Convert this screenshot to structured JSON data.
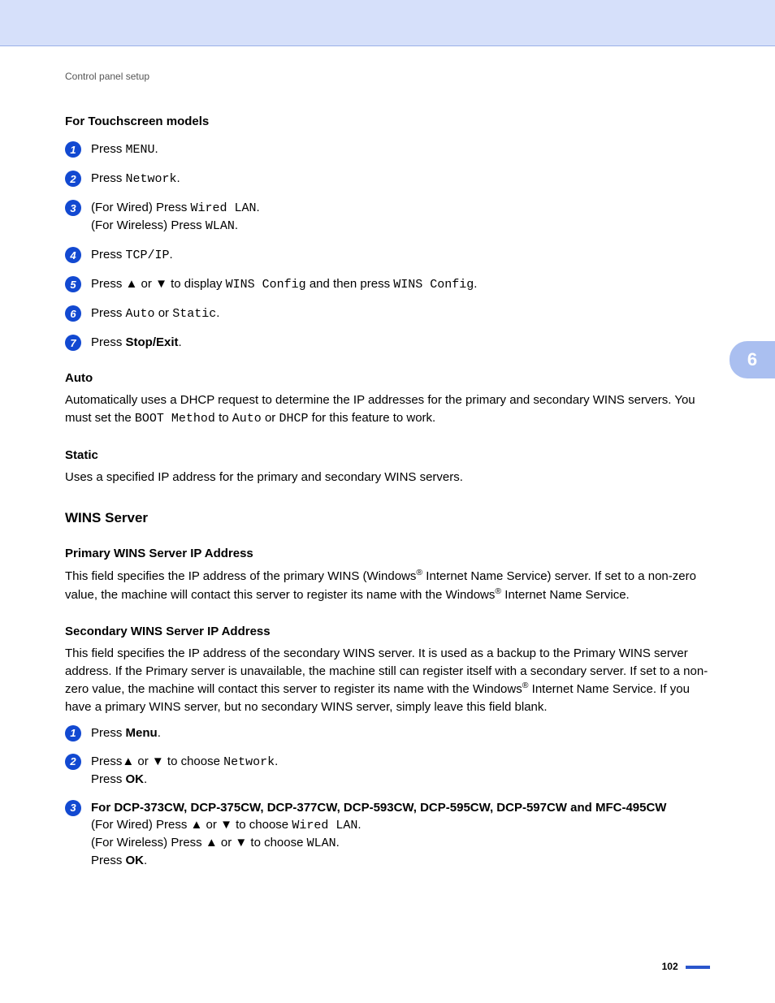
{
  "breadcrumb": "Control panel setup",
  "chapter_tab": "6",
  "page_number": "102",
  "section1": {
    "title": "For Touchscreen models",
    "steps": {
      "s1": {
        "press": "Press ",
        "menu": "MENU",
        "dot": "."
      },
      "s2": {
        "press": "Press ",
        "net": "Network",
        "dot": "."
      },
      "s3": {
        "wired_pre": "(For Wired) Press ",
        "wired_lan": "Wired LAN",
        "wired_dot": ".",
        "wireless_pre": "(For Wireless) Press ",
        "wlan": "WLAN",
        "wireless_dot": "."
      },
      "s4": {
        "press": "Press ",
        "tcp": "TCP/IP",
        "dot": "."
      },
      "s5": {
        "a": "Press ",
        "up": "▲",
        "b": " or ",
        "down": "▼",
        "c": " to display ",
        "wc1": "WINS Config",
        "d": " and then press ",
        "wc2": "WINS Config",
        "dot": "."
      },
      "s6": {
        "press": "Press ",
        "auto": "Auto",
        "or": " or ",
        "static": "Static",
        "dot": "."
      },
      "s7": {
        "press": "Press ",
        "se": "Stop/Exit",
        "dot": "."
      }
    }
  },
  "auto": {
    "title": "Auto",
    "t1": "Automatically uses a DHCP request to determine the IP addresses for the primary and secondary WINS servers. You must set the ",
    "bm": "BOOT Method",
    "t2": " to ",
    "a": "Auto",
    "t3": " or ",
    "d": "DHCP",
    "t4": " for this feature to work."
  },
  "static": {
    "title": "Static",
    "text": "Uses a specified IP address for the primary and secondary WINS servers."
  },
  "wins": {
    "heading": "WINS Server",
    "primary": {
      "title": "Primary WINS Server IP Address",
      "t1": "This field specifies the IP address of the primary WINS (Windows",
      "reg1": "®",
      "t2": " Internet Name Service) server. If set to a non-zero value, the machine will contact this server to register its name with the Windows",
      "reg2": "®",
      "t3": " Internet Name Service."
    },
    "secondary": {
      "title": "Secondary WINS Server IP Address",
      "t1": "This field specifies the IP address of the secondary WINS server. It is used as a backup to the Primary WINS server address. If the Primary server is unavailable, the machine still can register itself with a secondary server. If set to a non-zero value, the machine will contact this server to register its name with the Windows",
      "reg": "®",
      "t2": " Internet Name Service. If you have a primary WINS server, but no secondary WINS server, simply leave this field blank."
    },
    "steps": {
      "s1": {
        "press": "Press ",
        "menu": "Menu",
        "dot": "."
      },
      "s2": {
        "a": "Press",
        "up": "▲",
        "b": " or ",
        "down": "▼",
        "c": " to choose ",
        "net": "Network",
        "dot": ".",
        "pressok": "Press ",
        "ok": "OK",
        "dot2": "."
      },
      "s3": {
        "models": "For DCP-373CW, DCP-375CW, DCP-377CW, DCP-593CW, DCP-595CW, DCP-597CW and MFC-495CW",
        "wired_a": "(For Wired) Press ",
        "up1": "▲",
        "wired_b": " or ",
        "down1": "▼",
        "wired_c": " to choose ",
        "wlan_wired": "Wired LAN",
        "wired_dot": ".",
        "wireless_a": "(For Wireless) Press ",
        "up2": "▲",
        "wireless_b": " or ",
        "down2": "▼",
        "wireless_c": " to choose ",
        "wlan": "WLAN",
        "wireless_dot": ".",
        "pressok": "Press ",
        "ok": "OK",
        "dot2": "."
      }
    }
  }
}
